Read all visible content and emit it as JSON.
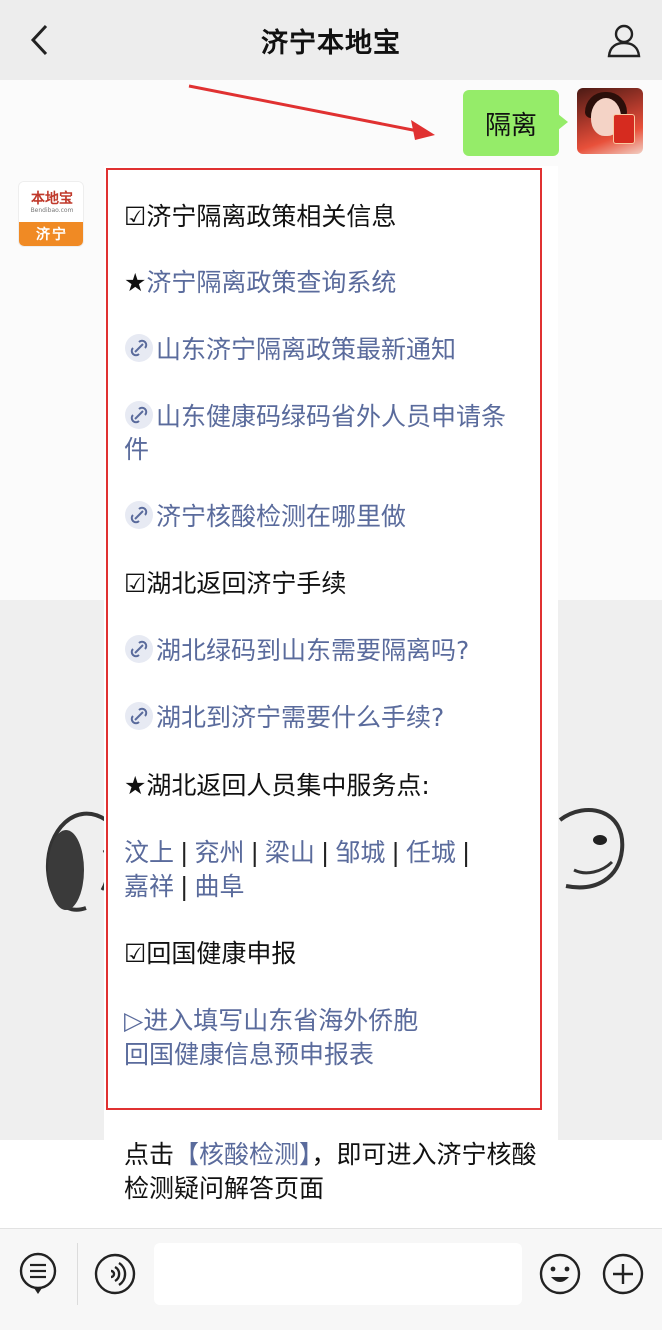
{
  "header": {
    "title": "济宁本地宝"
  },
  "chat": {
    "sent_message": "隔离",
    "bot_avatar": {
      "brand": "本地宝",
      "site": "Bendibao.com",
      "city": "济宁"
    },
    "reply_card": {
      "s1_heading": "☑济宁隔离政策相关信息",
      "s1_system": "济宁隔离政策查询系统",
      "s1_link1": "山东济宁隔离政策最新通知",
      "s1_link2": "山东健康码绿码省外人员申请条件",
      "s1_link3": "济宁核酸检测在哪里做",
      "s2_heading": "☑湖北返回济宁手续",
      "s2_link1": "湖北绿码到山东需要隔离吗?",
      "s2_link2": "湖北到济宁需要什么手续?",
      "s3_heading": "★湖北返回人员集中服务点:",
      "service_points": [
        "汶上",
        "兖州",
        "梁山",
        "邹城",
        "任城",
        "嘉祥",
        "曲阜"
      ],
      "s4_heading": "☑回国健康申报",
      "s4_link_line1": "▷进入填写山东省海外侨胞",
      "s4_link_line2": "回国健康信息预申报表"
    },
    "followup": {
      "prefix": "点击",
      "keyword": "【核酸检测】",
      "suffix": "，即可进入济宁核酸检测疑问解答页面"
    }
  },
  "bottom_bar": {
    "input_placeholder": ""
  },
  "colors": {
    "header_bg": "#ededed",
    "sent_bubble": "#95ec69",
    "link": "#5a6b9c",
    "annotation_red": "#e03131",
    "bot_orange": "#f08a24"
  },
  "icons": {
    "back": "chevron-left-icon",
    "profile": "person-icon",
    "link": "link-icon",
    "menu": "menu-icon",
    "voice": "voice-icon",
    "emoji": "emoji-icon",
    "more": "plus-circle-icon"
  }
}
